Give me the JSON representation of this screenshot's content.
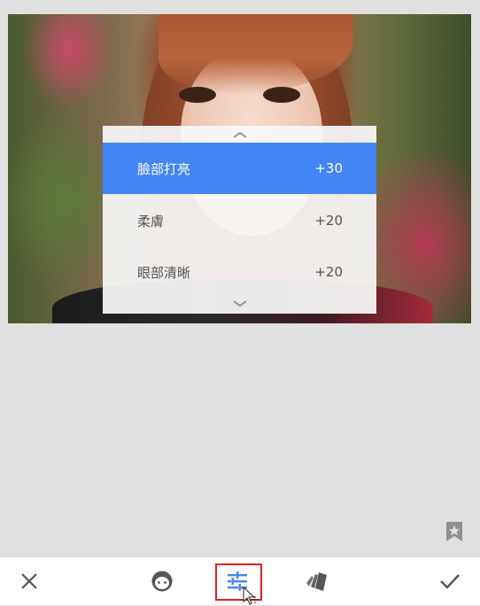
{
  "photo": {
    "subject": "portrait-photo"
  },
  "menu": {
    "scroll_up_icon": "chevron-up-icon",
    "scroll_down_icon": "chevron-down-icon",
    "items": [
      {
        "label": "臉部打亮",
        "value": "+30",
        "selected": true
      },
      {
        "label": "柔膚",
        "value": "+20",
        "selected": false
      },
      {
        "label": "眼部清晰",
        "value": "+20",
        "selected": false
      }
    ]
  },
  "colors": {
    "accent": "#4285f4",
    "highlight_box": "#e0201f",
    "background": "#e0e0e0",
    "toolbar": "#ffffff",
    "icon": "#555555"
  },
  "toolbar": {
    "buttons": [
      {
        "icon": "close-icon",
        "active": false
      },
      {
        "icon": "face-icon",
        "active": false
      },
      {
        "icon": "tune-sliders-icon",
        "active": true
      },
      {
        "icon": "styles-icon",
        "active": false
      },
      {
        "icon": "check-icon",
        "active": false
      }
    ]
  },
  "bookmark_icon": "bookmark-star-icon"
}
